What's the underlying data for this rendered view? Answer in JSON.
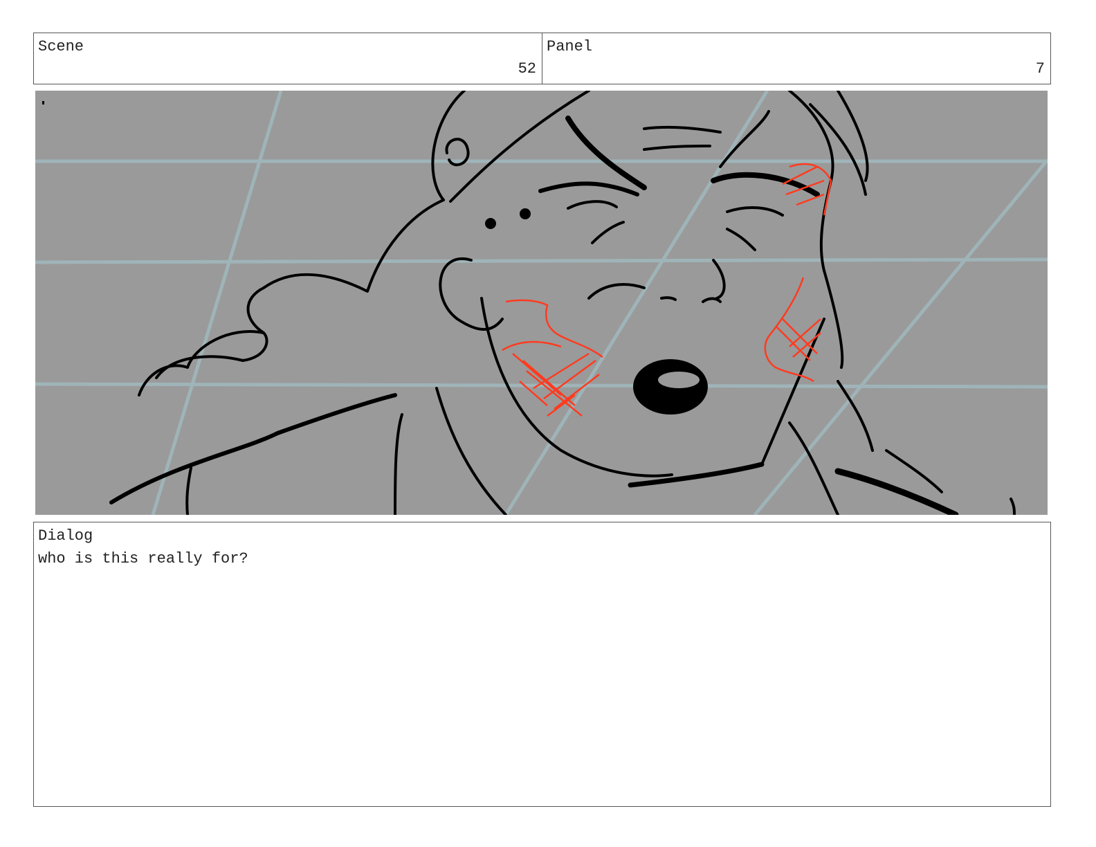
{
  "scene": {
    "label": "Scene",
    "value": "52"
  },
  "panel": {
    "label": "Panel",
    "value": "7"
  },
  "dialog": {
    "label": "Dialog",
    "text": "who is this really for?"
  },
  "artwork": {
    "background": "#9a9a9a",
    "guide_color": "#9fb4b8",
    "line_color": "#000000",
    "accent_color": "#ff3b1f"
  }
}
